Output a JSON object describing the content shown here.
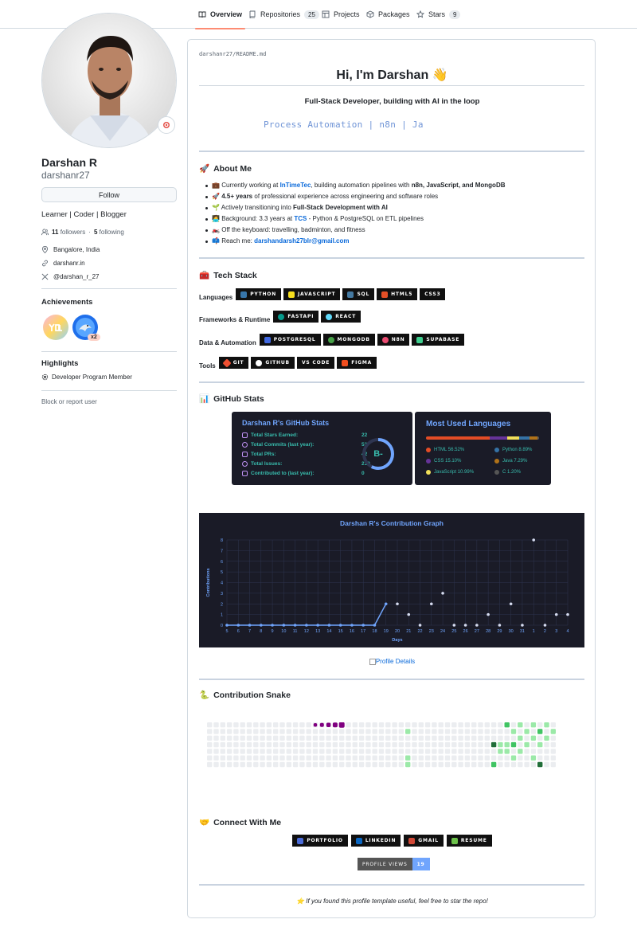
{
  "nav": {
    "tabs": [
      {
        "label": "Overview",
        "icon": "book-icon"
      },
      {
        "label": "Repositories",
        "count": "25",
        "icon": "repo-icon"
      },
      {
        "label": "Projects",
        "icon": "table-icon"
      },
      {
        "label": "Packages",
        "icon": "package-icon"
      },
      {
        "label": "Stars",
        "count": "9",
        "icon": "star-icon"
      }
    ]
  },
  "profile": {
    "name": "Darshan R",
    "login": "darshanr27",
    "follow_label": "Follow",
    "bio": "Learner | Coder | Blogger",
    "followers_count": "11",
    "followers_label": "followers",
    "following_count": "5",
    "following_label": "following",
    "location": "Bangalore, India",
    "website": "darshanr.in",
    "x_handle": "@darshan_r_27",
    "achievements_title": "Achievements",
    "achievement_badges": [
      {
        "name": "yolo-badge",
        "multiplier": ""
      },
      {
        "name": "pull-shark-badge",
        "multiplier": "x2"
      }
    ],
    "highlights_title": "Highlights",
    "highlight": "Developer Program Member",
    "block_label": "Block or report user"
  },
  "readme": {
    "path_user": "darshanr27",
    "path_sep": "/",
    "path_file": "README.md",
    "greeting": "Hi, I'm Darshan 👋",
    "subtitle": "Full-Stack Developer, building with AI in the loop",
    "typing": "Process Automation | n8n | Ja",
    "about_title": "About Me",
    "about_emoji": "🚀",
    "about": [
      {
        "emoji": "💼",
        "pre": "Currently working at ",
        "link": "InTimeTec",
        "mid": ", building automation pipelines with ",
        "bold": "n8n, JavaScript, and MongoDB",
        "post": ""
      },
      {
        "emoji": "🚀",
        "pre": "",
        "link": "",
        "mid": "",
        "bold": "4.5+ years",
        "post": " of professional experience across engineering and software roles"
      },
      {
        "emoji": "🌱",
        "pre": "Actively transitioning into ",
        "link": "",
        "mid": "",
        "bold": "Full-Stack Development with AI",
        "post": ""
      },
      {
        "emoji": "🧑‍💻",
        "pre": "Background: 3.3 years at ",
        "link": "TCS",
        "mid": "",
        "bold": "",
        "post": " - Python & PostgreSQL on ETL pipelines"
      },
      {
        "emoji": "🏍️",
        "pre": "Off the keyboard: travelling, badminton, and fitness",
        "link": "",
        "mid": "",
        "bold": "",
        "post": ""
      },
      {
        "emoji": "📫",
        "pre": "Reach me: ",
        "link": "darshandarsh27blr@gmail.com",
        "mid": "",
        "bold": "",
        "post": ""
      }
    ],
    "tech_title": "Tech Stack",
    "tech_emoji": "🧰",
    "tech_rows": [
      {
        "label": "Languages",
        "badges": [
          {
            "text": "PYTHON",
            "color": "#3776ab"
          },
          {
            "text": "JAVASCRIPT",
            "color": "#f7df1e"
          },
          {
            "text": "SQL",
            "color": "#4479a1"
          },
          {
            "text": "HTML5",
            "color": "#e34f26"
          },
          {
            "text": "CSS3",
            "color": "#1572b6"
          }
        ]
      },
      {
        "label": "Frameworks & Runtime",
        "badges": [
          {
            "text": "FASTAPI",
            "color": "#05998b"
          },
          {
            "text": "REACT",
            "color": "#61dafb"
          }
        ]
      },
      {
        "label": "Data & Automation",
        "badges": [
          {
            "text": "POSTGRESQL",
            "color": "#4169e1"
          },
          {
            "text": "MONGODB",
            "color": "#47a248"
          },
          {
            "text": "N8N",
            "color": "#ea4b71"
          },
          {
            "text": "SUPABASE",
            "color": "#3ecf8e"
          }
        ]
      },
      {
        "label": "Tools",
        "badges": [
          {
            "text": "GIT",
            "color": "#f05032"
          },
          {
            "text": "GITHUB",
            "color": "#ffffff"
          },
          {
            "text": "VS CODE",
            "color": "#101010"
          },
          {
            "text": "FIGMA",
            "color": "#f24e1e"
          }
        ]
      }
    ],
    "stats_title_section": "GitHub Stats",
    "stats_emoji": "📊",
    "stats_card": {
      "title": "Darshan R's GitHub Stats",
      "rows": [
        {
          "label": "Total Stars Earned:",
          "value": "22"
        },
        {
          "label": "Total Commits (last year):",
          "value": "53"
        },
        {
          "label": "Total PRs:",
          "value": "42"
        },
        {
          "label": "Total Issues:",
          "value": "210"
        },
        {
          "label": "Contributed to (last year):",
          "value": "0"
        }
      ],
      "rank": "B-"
    },
    "langs_card": {
      "title": "Most Used Languages",
      "items": [
        {
          "name": "HTML 56.52%",
          "color": "#e34c26",
          "pct": 56.52
        },
        {
          "name": "Python 8.89%",
          "color": "#3572a5",
          "pct": 8.89
        },
        {
          "name": "CSS 15.10%",
          "color": "#663399",
          "pct": 15.1
        },
        {
          "name": "Java 7.29%",
          "color": "#b07219",
          "pct": 7.29
        },
        {
          "name": "JavaScript 10.99%",
          "color": "#f1e05a",
          "pct": 10.99
        },
        {
          "name": "C 1.20%",
          "color": "#555555",
          "pct": 1.2
        }
      ]
    },
    "profile_details_alt": "Profile Details",
    "snake_title": "Contribution Snake",
    "snake_emoji": "🐍",
    "connect_title": "Connect With Me",
    "connect_emoji": "🤝",
    "connect_badges": [
      {
        "text": "PORTFOLIO",
        "color": "#4a6bd8"
      },
      {
        "text": "LINKEDIN",
        "color": "#0a66c2"
      },
      {
        "text": "GMAIL",
        "color": "#d14836"
      },
      {
        "text": "RESUME",
        "color": "#6cc24a"
      }
    ],
    "views_label": "PROFILE VIEWS",
    "views_count": "19",
    "footer": "⭐ If you found this profile template useful, feel free to star the repo!"
  },
  "chart_data": {
    "type": "line",
    "title": "Darshan R's Contribution Graph",
    "xlabel": "Days",
    "ylabel": "Contributions",
    "categories": [
      "5",
      "6",
      "7",
      "8",
      "9",
      "10",
      "11",
      "12",
      "13",
      "14",
      "15",
      "16",
      "17",
      "18",
      "19",
      "20",
      "21",
      "22",
      "23",
      "24",
      "25",
      "26",
      "27",
      "28",
      "29",
      "30",
      "31",
      "1",
      "2",
      "3",
      "4"
    ],
    "values": [
      0,
      0,
      0,
      0,
      0,
      0,
      0,
      0,
      0,
      0,
      0,
      0,
      0,
      0,
      2,
      2,
      1,
      0,
      2,
      3,
      0,
      0,
      0,
      1,
      0,
      2,
      0,
      8,
      0,
      1,
      1
    ],
    "ylim": [
      0,
      8
    ],
    "yticks": [
      "0",
      "1",
      "2",
      "3",
      "4",
      "5",
      "6",
      "7",
      "8"
    ],
    "grid": true,
    "colors": {
      "line": "#70a5fd",
      "point": "#bf91f3",
      "title": "#70a5fd",
      "axis": "#70a5fd"
    }
  }
}
